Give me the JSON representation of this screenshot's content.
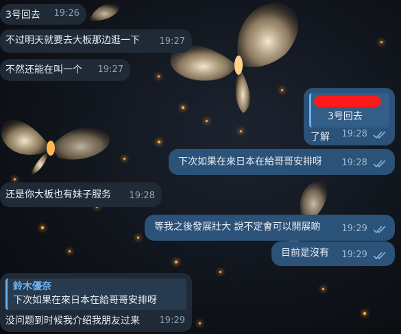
{
  "messages": [
    {
      "text": "3号回去",
      "time": "19:26"
    },
    {
      "text": "不过明天就要去大板那边逛一下",
      "time": "19:27"
    },
    {
      "text": "不然还能在叫一个",
      "time": "19:27"
    },
    {
      "reply_to": "3号回去",
      "text": "了解",
      "time": "19:28"
    },
    {
      "text": "下次如果在來日本在給哥哥安排呀",
      "time": "19:28"
    },
    {
      "text": "还是你大板也有妹子服务",
      "time": "19:28"
    },
    {
      "text": "等我之後發展壯大 說不定會可以開展啲",
      "time": "19:29"
    },
    {
      "text": "目前是沒有",
      "time": "19:29"
    },
    {
      "reply_name": "鈴木優奈",
      "reply_to": "下次如果在來日本在給哥哥安排呀",
      "text": "没问题到时候我介绍我朋友过来",
      "time": "19:29"
    }
  ],
  "colors": {
    "incoming": "#1f2a36",
    "outgoing": "#2b5278",
    "accent": "#6ab3f3"
  }
}
